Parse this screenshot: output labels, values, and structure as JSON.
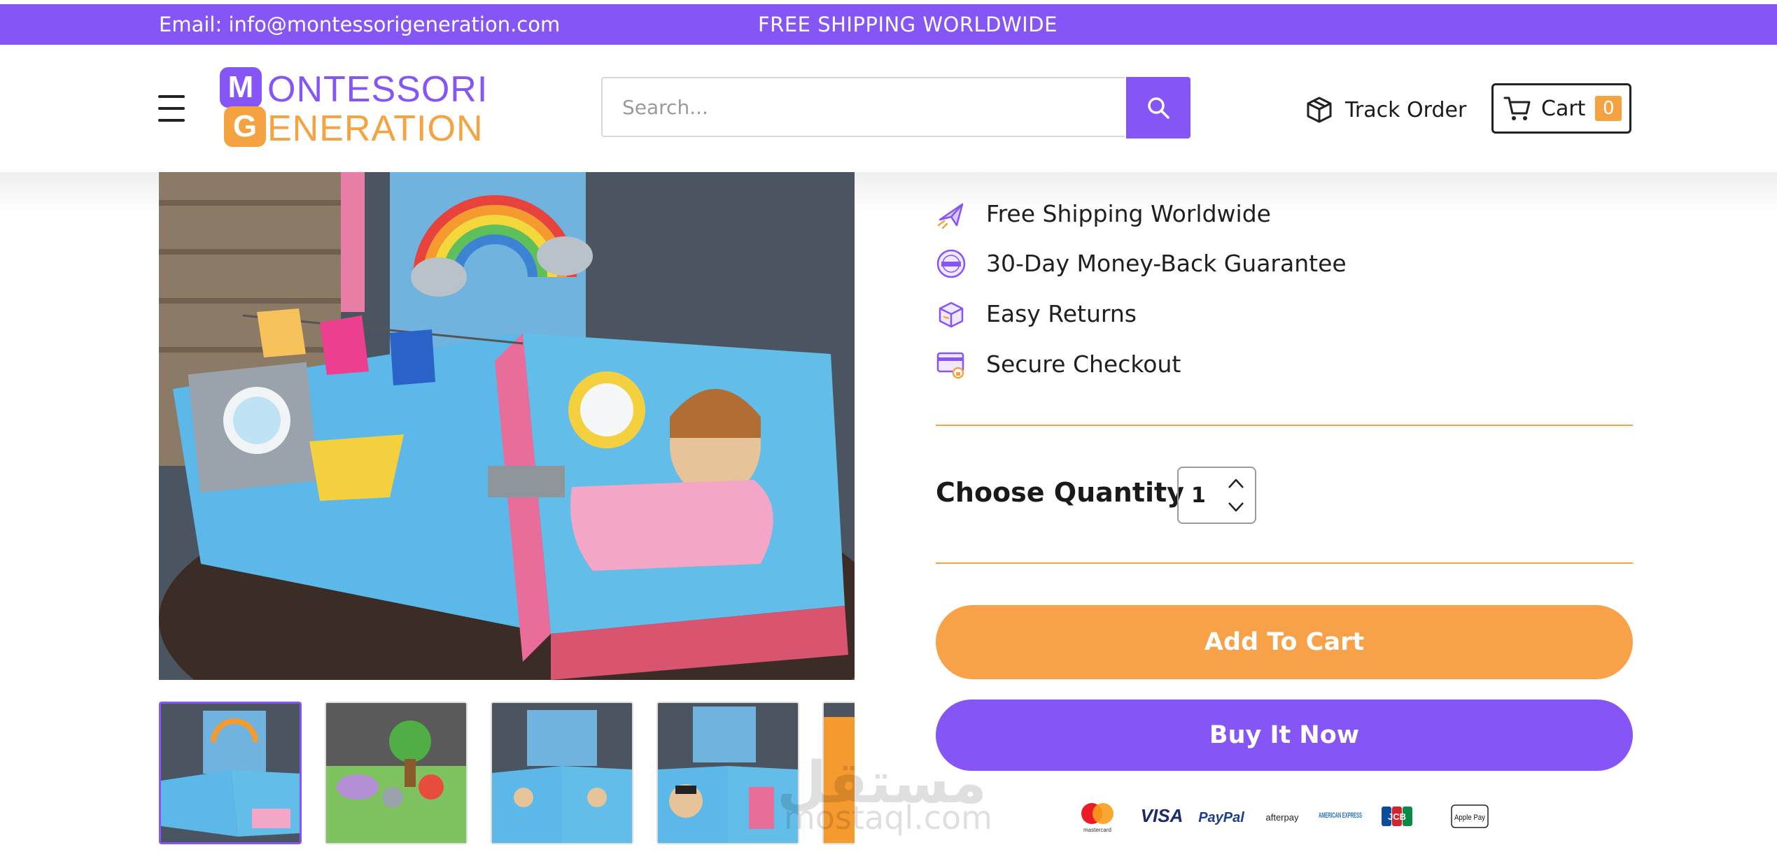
{
  "topbar": {
    "email": "Email: info@montessorigeneration.com",
    "shipping": "FREE SHIPPING WORLDWIDE"
  },
  "logo": {
    "line1": "ONTESSORI",
    "line2": "ENERATION",
    "badge1": "M",
    "badge2": "G"
  },
  "search": {
    "placeholder": "Search..."
  },
  "nav": {
    "track_order": "Track Order",
    "cart_label": "Cart",
    "cart_count": "0"
  },
  "features": [
    {
      "icon": "plane-icon",
      "label": "Free Shipping Worldwide"
    },
    {
      "icon": "guarantee-badge-icon",
      "label": "30-Day Money-Back Guarantee"
    },
    {
      "icon": "return-box-icon",
      "label": "Easy Returns"
    },
    {
      "icon": "secure-card-icon",
      "label": "Secure Checkout"
    }
  ],
  "quantity": {
    "label": "Choose Quantity",
    "value": "1"
  },
  "buttons": {
    "add_to_cart": "Add To Cart",
    "buy_now": "Buy It Now"
  },
  "payments": [
    "mastercard",
    "VISA",
    "PayPal",
    "afterpay",
    "AMERICAN EXPRESS",
    "JCB",
    "Apple Pay"
  ],
  "watermark": {
    "arabic": "مستقل",
    "latin": "mostaql.com"
  },
  "colors": {
    "brand_purple": "#8655f6",
    "brand_orange": "#f5a241"
  }
}
